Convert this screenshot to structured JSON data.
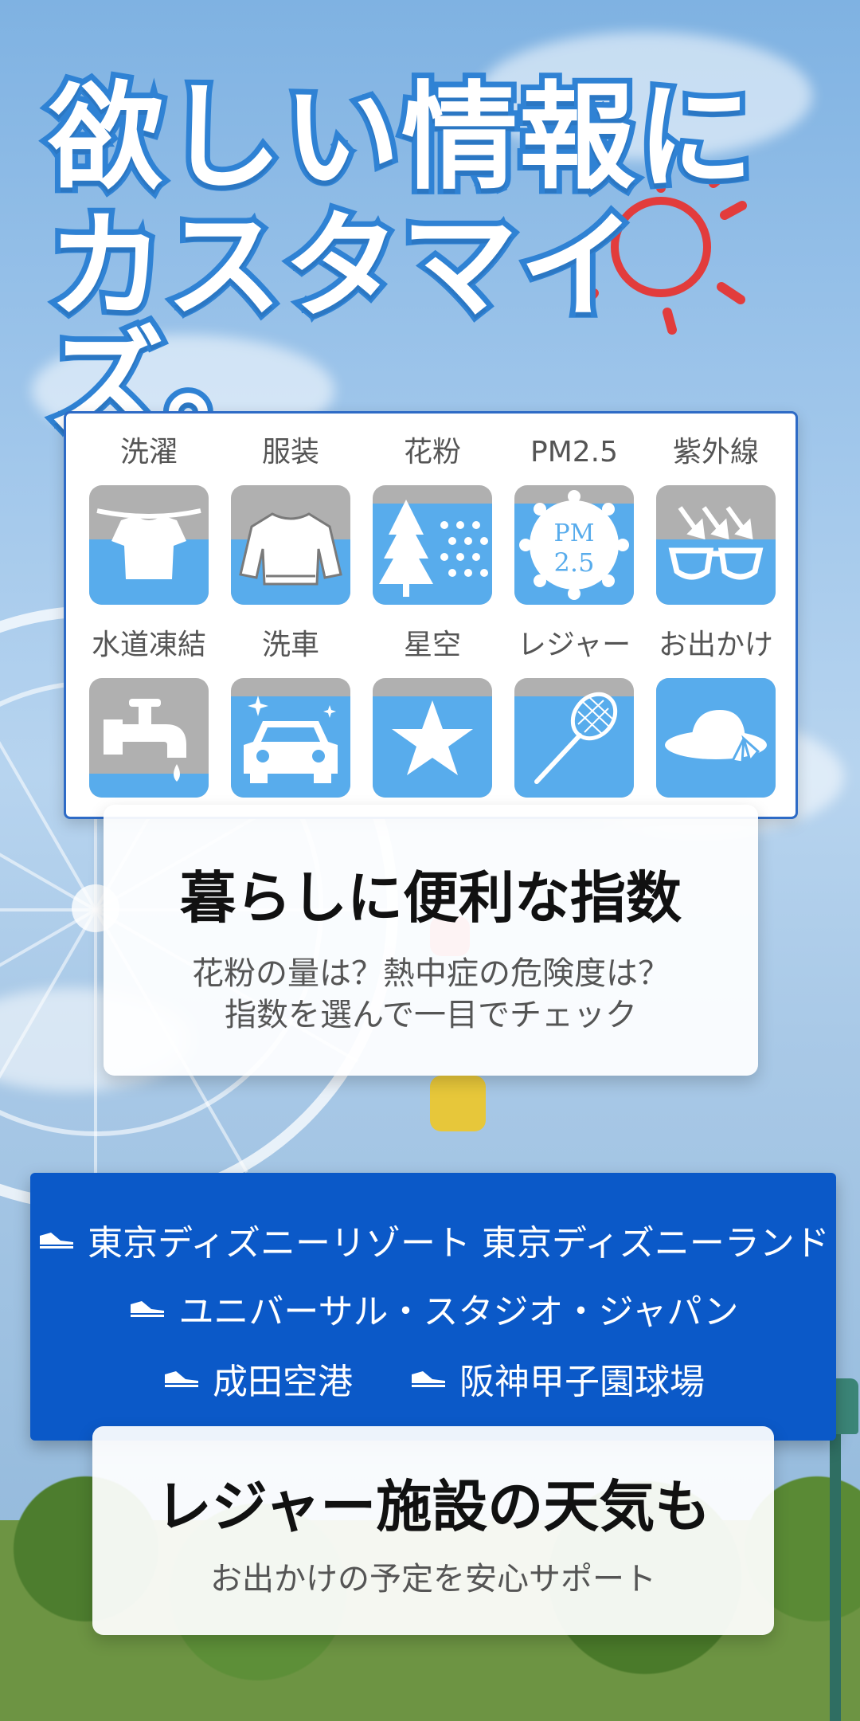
{
  "headline": {
    "line1": "欲しい情報に",
    "line2": "カスタマイズ。"
  },
  "indices": {
    "row1": [
      {
        "label": "洗濯",
        "icon": "laundry-icon",
        "level": 0.55
      },
      {
        "label": "服装",
        "icon": "sweater-icon",
        "level": 0.55
      },
      {
        "label": "花粉",
        "icon": "cedar-pollen-icon",
        "level": 0.85
      },
      {
        "label": "PM2.5",
        "icon": "pm25-icon",
        "level": 0.85
      },
      {
        "label": "紫外線",
        "icon": "uv-sunglasses-icon",
        "level": 0.55
      }
    ],
    "row2": [
      {
        "label": "水道凍結",
        "icon": "faucet-icon",
        "level": 0.2
      },
      {
        "label": "洗車",
        "icon": "car-icon",
        "level": 0.85
      },
      {
        "label": "星空",
        "icon": "star-icon",
        "level": 0.85
      },
      {
        "label": "レジャー",
        "icon": "racket-icon",
        "level": 0.85
      },
      {
        "label": "お出かけ",
        "icon": "hat-icon",
        "level": 1.0
      }
    ]
  },
  "feature1": {
    "title": "暮らしに便利な指数",
    "text1": "花粉の量は？熱中症の危険度は？",
    "text2": "指数を選んで一目でチェック"
  },
  "venues": [
    "東京ディズニーリゾート 東京ディズニーランド",
    "ユニバーサル・スタジオ・ジャパン",
    "成田空港",
    "阪神甲子園球場"
  ],
  "feature2": {
    "title": "レジャー施設の天気も",
    "text": "お出かけの予定を安心サポート"
  },
  "colors": {
    "headline_stroke": "#2f82d4",
    "tile_fill": "#58acec",
    "tile_empty": "#b0b0b0",
    "venue_box": "#0b59c8",
    "card_border": "#2e6bc6"
  }
}
